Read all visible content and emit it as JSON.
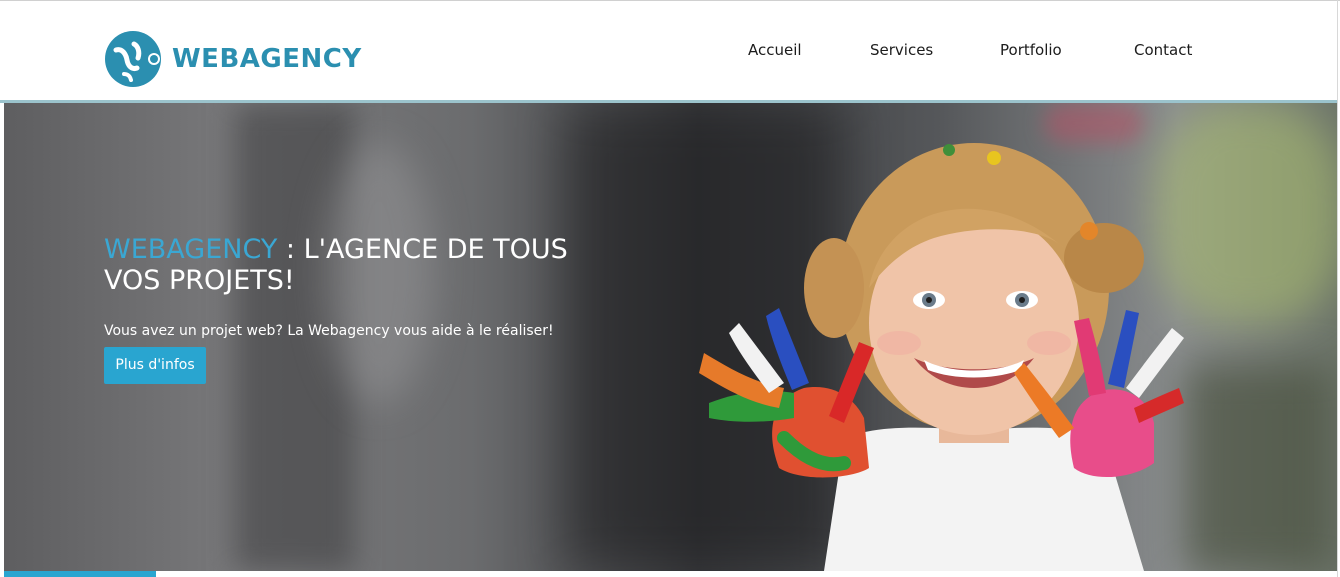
{
  "header": {
    "logo_text": "WEBAGENCY",
    "logo_icon": "webagency-logo-icon",
    "nav": [
      {
        "label": "Accueil"
      },
      {
        "label": "Services"
      },
      {
        "label": "Portfolio"
      },
      {
        "label": "Contact"
      }
    ]
  },
  "hero": {
    "title_brand": "WEBAGENCY",
    "title_rest": " : L'AGENCE DE TOUS VOS PROJETS!",
    "subtitle": "Vous avez un projet web? La Webagency vous aide à le réaliser!",
    "button_label": "Plus d'infos",
    "image": "girl-with-painted-hands-photo"
  },
  "colors": {
    "brand": "#2b8fb0",
    "accent": "#29a5d0",
    "title_brand": "#3aa7d3"
  }
}
